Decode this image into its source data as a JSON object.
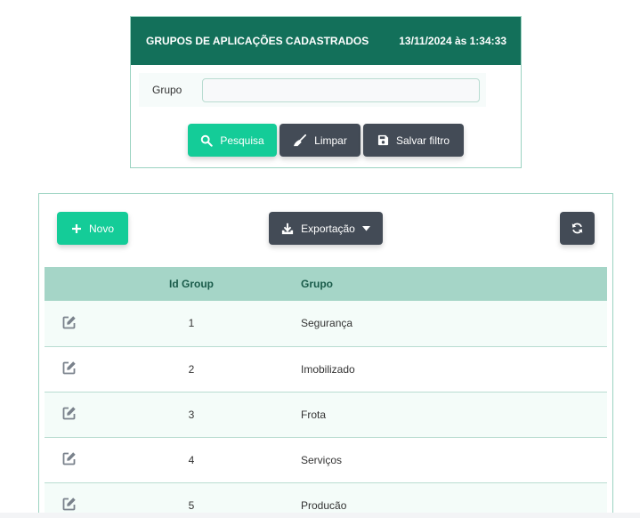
{
  "filter": {
    "title": "GRUPOS DE APLICAÇÕES CADASTRADOS",
    "timestamp": "13/11/2024 às 1:34:33",
    "group_label": "Grupo",
    "group_value": "",
    "search_label": "Pesquisa",
    "clear_label": "Limpar",
    "save_filter_label": "Salvar filtro"
  },
  "toolbar": {
    "new_label": "Novo",
    "export_label": "Exportação",
    "refresh_icon": "refresh-icon"
  },
  "table": {
    "columns": [
      "",
      "Id Group",
      "Grupo"
    ],
    "rows": [
      {
        "id": "1",
        "group": "Segurança"
      },
      {
        "id": "2",
        "group": "Imobilizado"
      },
      {
        "id": "3",
        "group": "Frota"
      },
      {
        "id": "4",
        "group": "Serviços"
      },
      {
        "id": "5",
        "group": "Producão"
      }
    ]
  },
  "colors": {
    "header_bg": "#13705a",
    "primary_green": "#14cc98",
    "dark_button": "#434b56",
    "table_header": "#a5d5c7",
    "border": "#9bd3c1"
  }
}
